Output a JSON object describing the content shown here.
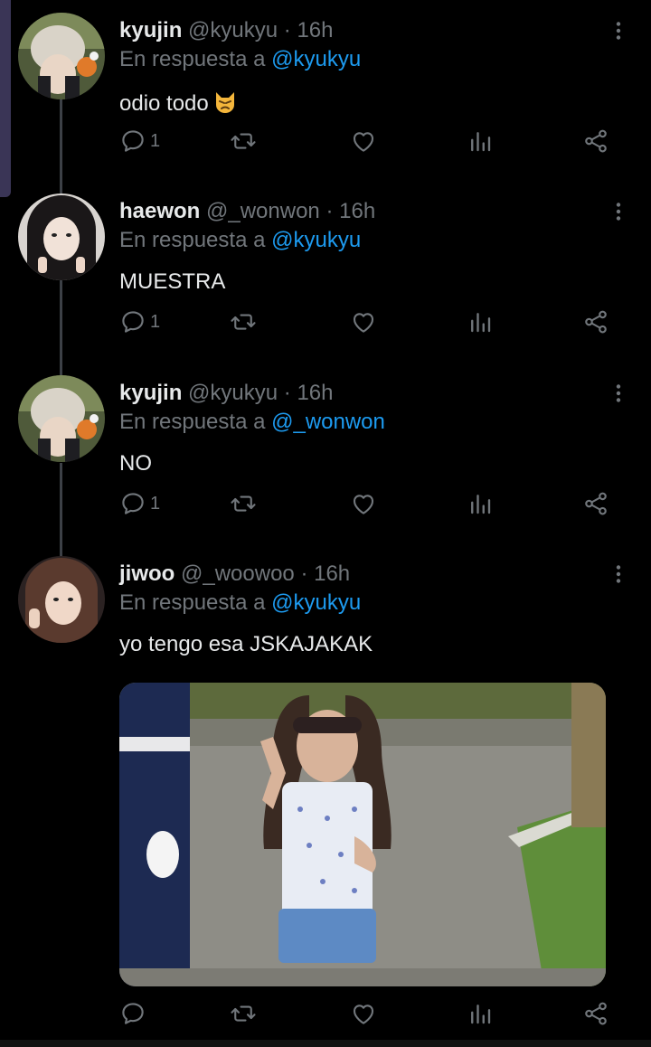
{
  "colors": {
    "background": "#000000",
    "text": "#e7e9ea",
    "muted": "#71767b",
    "mention": "#1d9bf0",
    "thread_line": "#3c4046"
  },
  "icons": {
    "reply": "reply-icon",
    "retweet": "retweet-icon",
    "like": "heart-icon",
    "views": "views-icon",
    "share": "share-icon",
    "menu": "more-vertical-icon",
    "emoji": "pouting-cat-emoji"
  },
  "tweets": [
    {
      "name": "kyujin",
      "handle": "@kyukyu",
      "separator": "·",
      "time": "16h",
      "reply_prefix": "En respuesta a",
      "reply_to": "@kyukyu",
      "text": "odio todo",
      "reply_count": "1"
    },
    {
      "name": "haewon",
      "handle": "@_wonwon",
      "separator": "·",
      "time": "16h",
      "reply_prefix": "En respuesta a",
      "reply_to": "@kyukyu",
      "text": "MUESTRA",
      "reply_count": "1"
    },
    {
      "name": "kyujin",
      "handle": "@kyukyu",
      "separator": "·",
      "time": "16h",
      "reply_prefix": "En respuesta a",
      "reply_to": "@_wonwon",
      "text": "NO",
      "reply_count": "1"
    },
    {
      "name": "jiwoo",
      "handle": "@_woowoo",
      "separator": "·",
      "time": "16h",
      "reply_prefix": "En respuesta a",
      "reply_to": "@kyukyu",
      "text": "yo tengo esa JSKAJAKAK",
      "reply_count": ""
    }
  ]
}
